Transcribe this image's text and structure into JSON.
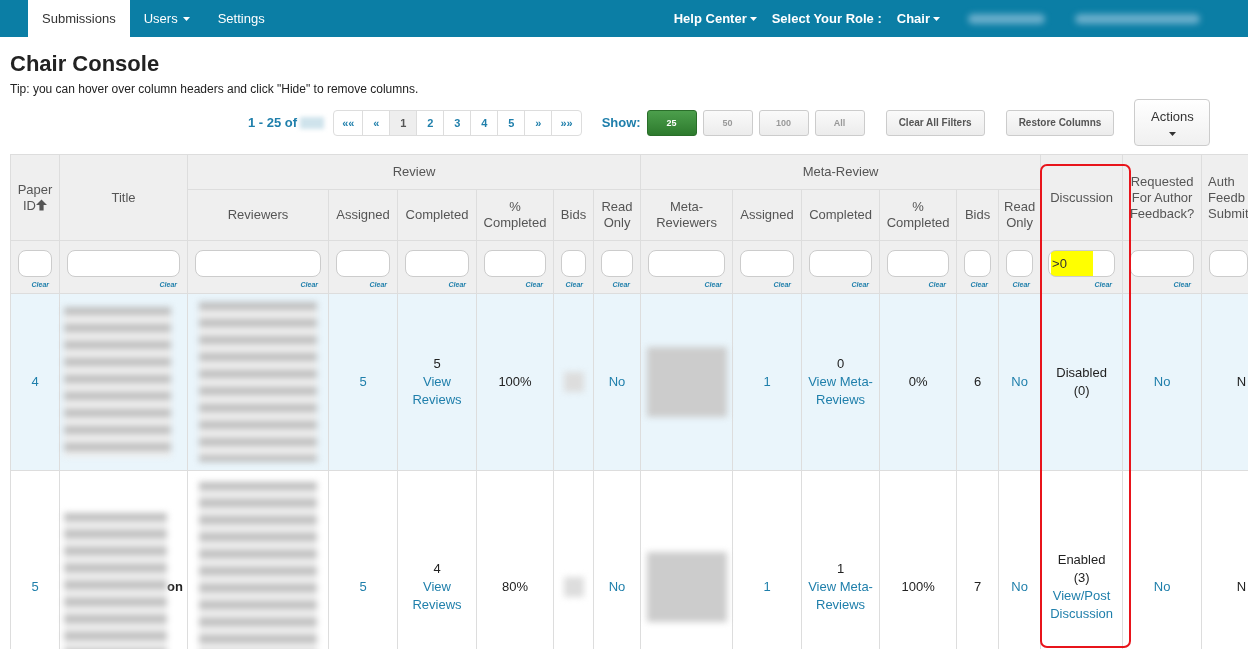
{
  "nav": {
    "tabs": [
      {
        "label": "Submissions",
        "selected": true,
        "dropdown": false
      },
      {
        "label": "Users",
        "selected": false,
        "dropdown": true
      },
      {
        "label": "Settings",
        "selected": false,
        "dropdown": false
      }
    ],
    "right": [
      {
        "kind": "menu",
        "label": "Help Center"
      },
      {
        "kind": "text",
        "label": "Select Your Role :"
      },
      {
        "kind": "menu",
        "label": "Chair"
      },
      {
        "kind": "redacted"
      },
      {
        "kind": "redacted"
      }
    ]
  },
  "page": {
    "title": "Chair Console",
    "tip": "Tip: you can hover over column headers and click \"Hide\" to remove columns."
  },
  "toolbar": {
    "range": "1 - 25 of",
    "range_total_redacted": true,
    "pages": [
      {
        "label": "««",
        "selected": false
      },
      {
        "label": "«",
        "selected": false
      },
      {
        "label": "1",
        "selected": true
      },
      {
        "label": "2",
        "selected": false
      },
      {
        "label": "3",
        "selected": false
      },
      {
        "label": "4",
        "selected": false
      },
      {
        "label": "5",
        "selected": false
      },
      {
        "label": "»",
        "selected": false
      },
      {
        "label": "»»",
        "selected": false
      }
    ],
    "show_label": "Show:",
    "show_options": [
      {
        "label": "25",
        "selected": true
      },
      {
        "label": "50",
        "selected": false
      },
      {
        "label": "100",
        "selected": false
      },
      {
        "label": "All",
        "selected": false
      }
    ],
    "buttons": [
      "Clear All Filters",
      "Restore Columns"
    ],
    "actions": {
      "label": "Actions",
      "dropdown": true
    }
  },
  "table": {
    "columns": [
      {
        "kind": "single",
        "label": "Paper ID",
        "sorted": true,
        "highlighted": false,
        "filter": {
          "highlighted": false,
          "clear": "Clear"
        }
      },
      {
        "kind": "single",
        "label": "Title",
        "sorted": false,
        "highlighted": false,
        "filter": {
          "highlighted": false,
          "clear": "Clear"
        }
      },
      {
        "kind": "group",
        "label": "Review",
        "colspan": 6,
        "columns": [
          {
            "label": "Reviewers",
            "sorted": false,
            "highlighted": false,
            "filter": {
              "highlighted": false,
              "clear": "Clear"
            }
          },
          {
            "label": "Assigned",
            "sorted": false,
            "highlighted": false,
            "filter": {
              "highlighted": false,
              "clear": "Clear"
            }
          },
          {
            "label": "Completed",
            "sorted": false,
            "highlighted": false,
            "filter": {
              "highlighted": false,
              "clear": "Clear"
            }
          },
          {
            "label": "% Completed",
            "sorted": false,
            "highlighted": false,
            "filter": {
              "highlighted": false,
              "clear": "Clear"
            }
          },
          {
            "label": "Bids",
            "sorted": false,
            "highlighted": false,
            "filter": {
              "highlighted": false,
              "clear": "Clear"
            }
          },
          {
            "label": "Read Only",
            "sorted": false,
            "highlighted": false,
            "filter": {
              "highlighted": false,
              "clear": "Clear"
            }
          }
        ]
      },
      {
        "kind": "group",
        "label": "Meta-Review",
        "colspan": 6,
        "columns": [
          {
            "label": "Meta-Reviewers",
            "sorted": false,
            "highlighted": false,
            "filter": {
              "highlighted": false,
              "clear": "Clear"
            }
          },
          {
            "label": "Assigned",
            "sorted": false,
            "highlighted": false,
            "filter": {
              "highlighted": false,
              "clear": "Clear"
            }
          },
          {
            "label": "Completed",
            "sorted": false,
            "highlighted": false,
            "filter": {
              "highlighted": false,
              "clear": "Clear"
            }
          },
          {
            "label": "% Completed",
            "sorted": false,
            "highlighted": false,
            "filter": {
              "highlighted": false,
              "clear": "Clear"
            }
          },
          {
            "label": "Bids",
            "sorted": false,
            "highlighted": false,
            "filter": {
              "highlighted": false,
              "clear": "Clear"
            }
          },
          {
            "label": "Read Only",
            "sorted": false,
            "highlighted": false,
            "filter": {
              "highlighted": false,
              "clear": "Clear"
            }
          }
        ]
      },
      {
        "kind": "single",
        "label": "Discussion",
        "sorted": false,
        "highlighted": true,
        "filter": {
          "value": ">0",
          "highlighted": true,
          "clear": "Clear"
        }
      },
      {
        "kind": "single",
        "label": "Requested For Author Feedback?",
        "sorted": false,
        "highlighted": false,
        "filter": {
          "highlighted": false,
          "clear": "Clear"
        }
      },
      {
        "kind": "single",
        "label": "Auth Feedb Submit",
        "sorted": false,
        "highlighted": false,
        "filter": {
          "highlighted": false
        }
      }
    ],
    "rows": [
      {
        "highlighted": true,
        "cells": [
          {
            "kind": "link",
            "text": "4"
          },
          {
            "kind": "redacted"
          },
          {
            "kind": "redacted"
          },
          {
            "kind": "link",
            "text": "5"
          },
          {
            "kind": "stack",
            "lines": [
              {
                "kind": "text",
                "text": "5"
              },
              {
                "kind": "link",
                "text": "View Reviews"
              }
            ]
          },
          {
            "kind": "text",
            "text": "100%"
          },
          {
            "kind": "redacted"
          },
          {
            "kind": "link",
            "text": "No"
          },
          {
            "kind": "redacted"
          },
          {
            "kind": "link",
            "text": "1"
          },
          {
            "kind": "stack",
            "lines": [
              {
                "kind": "text",
                "text": "0"
              },
              {
                "kind": "link",
                "text": "View Meta-Reviews"
              }
            ]
          },
          {
            "kind": "text",
            "text": "0%"
          },
          {
            "kind": "text",
            "text": "6"
          },
          {
            "kind": "link",
            "text": "No"
          },
          {
            "kind": "stack",
            "lines": [
              {
                "kind": "text",
                "text": "Disabled"
              },
              {
                "kind": "text",
                "text": "(0)"
              }
            ]
          },
          {
            "kind": "link",
            "text": "No"
          },
          {
            "kind": "text",
            "text": "N"
          }
        ]
      },
      {
        "highlighted": false,
        "cells": [
          {
            "kind": "link",
            "text": "5"
          },
          {
            "kind": "redacted",
            "fragment": "on"
          },
          {
            "kind": "redacted"
          },
          {
            "kind": "link",
            "text": "5"
          },
          {
            "kind": "stack",
            "lines": [
              {
                "kind": "text",
                "text": "4"
              },
              {
                "kind": "link",
                "text": "View Reviews"
              }
            ]
          },
          {
            "kind": "text",
            "text": "80%"
          },
          {
            "kind": "redacted"
          },
          {
            "kind": "link",
            "text": "No"
          },
          {
            "kind": "redacted"
          },
          {
            "kind": "link",
            "text": "1"
          },
          {
            "kind": "stack",
            "lines": [
              {
                "kind": "text",
                "text": "1"
              },
              {
                "kind": "link",
                "text": "View Meta-Reviews"
              }
            ]
          },
          {
            "kind": "text",
            "text": "100%"
          },
          {
            "kind": "text",
            "text": "7"
          },
          {
            "kind": "link",
            "text": "No"
          },
          {
            "kind": "stack",
            "lines": [
              {
                "kind": "text",
                "text": "Enabled"
              },
              {
                "kind": "text",
                "text": "(3)"
              },
              {
                "kind": "link",
                "text": "View/Post Discussion"
              }
            ]
          },
          {
            "kind": "link",
            "text": "No"
          },
          {
            "kind": "text",
            "text": "N"
          }
        ]
      }
    ]
  }
}
